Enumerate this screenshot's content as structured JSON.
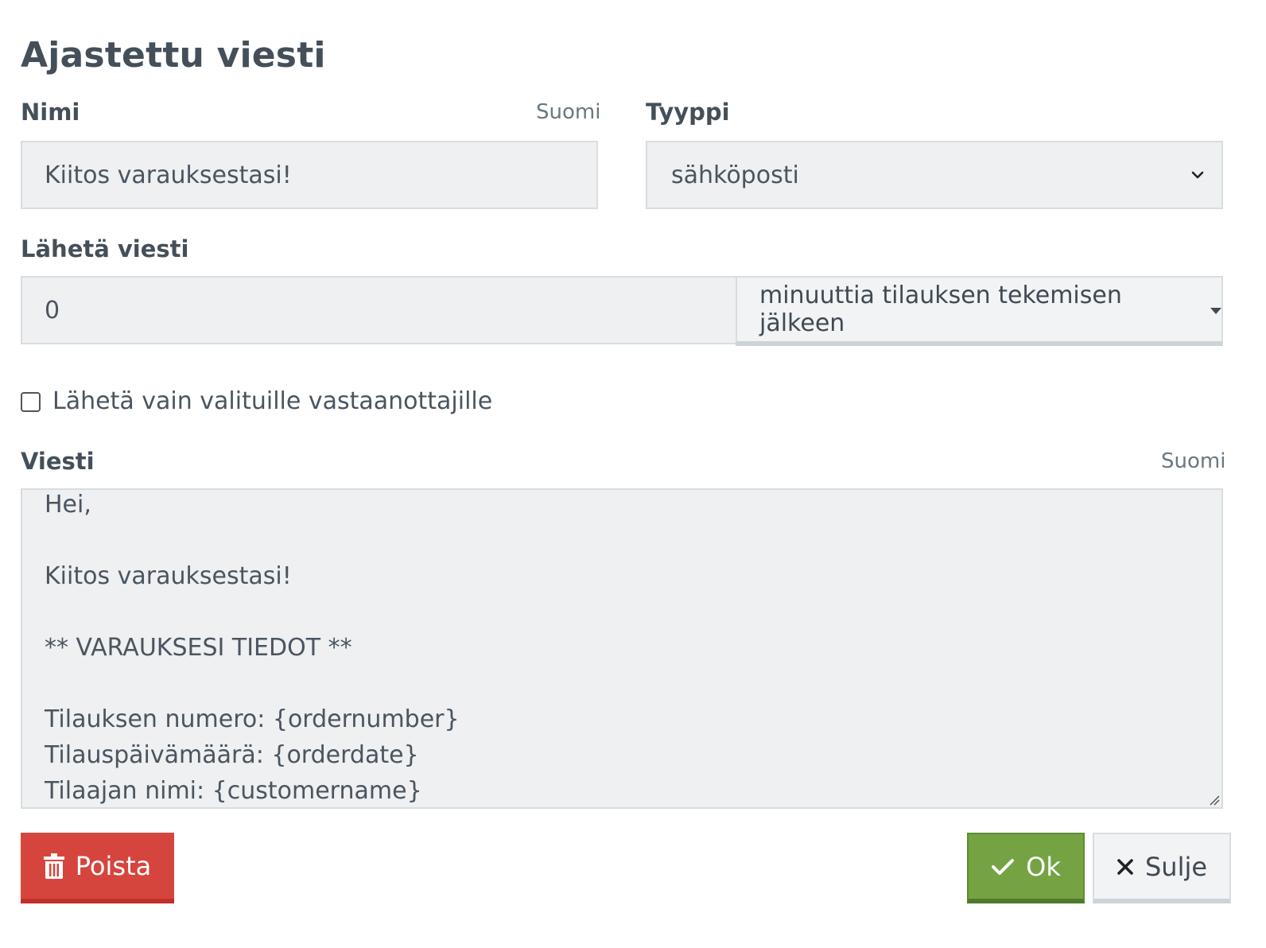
{
  "dialog": {
    "title": "Ajastettu viesti"
  },
  "name_field": {
    "label": "Nimi",
    "language": "Suomi",
    "value": "Kiitos varauksestasi!"
  },
  "type_field": {
    "label": "Tyyppi",
    "value": "sähköposti"
  },
  "send_field": {
    "label": "Lähetä viesti",
    "amount": "0",
    "unit": "minuuttia tilauksen tekemisen jälkeen"
  },
  "only_selected": {
    "label": "Lähetä vain valituille vastaanottajille",
    "checked": false
  },
  "message_field": {
    "label": "Viesti",
    "language": "Suomi",
    "lines": [
      "Hei,",
      "",
      "Kiitos varauksestasi!",
      "",
      "** VARAUKSESI TIEDOT **",
      "",
      "Tilauksen numero: {ordernumber}",
      "Tilauspäivämäärä: {orderdate}",
      "Tilaajan nimi: {customername}"
    ]
  },
  "buttons": {
    "delete_label": "Poista",
    "ok_label": "Ok",
    "close_label": "Sulje"
  },
  "colors": {
    "delete": "#d6453d",
    "ok": "#75a344",
    "text": "#444f59"
  },
  "icons": {
    "delete": "trash-icon",
    "ok": "check-icon",
    "close": "close-icon",
    "type_select": "chevron-down-icon",
    "unit_select": "caret-down-icon"
  }
}
